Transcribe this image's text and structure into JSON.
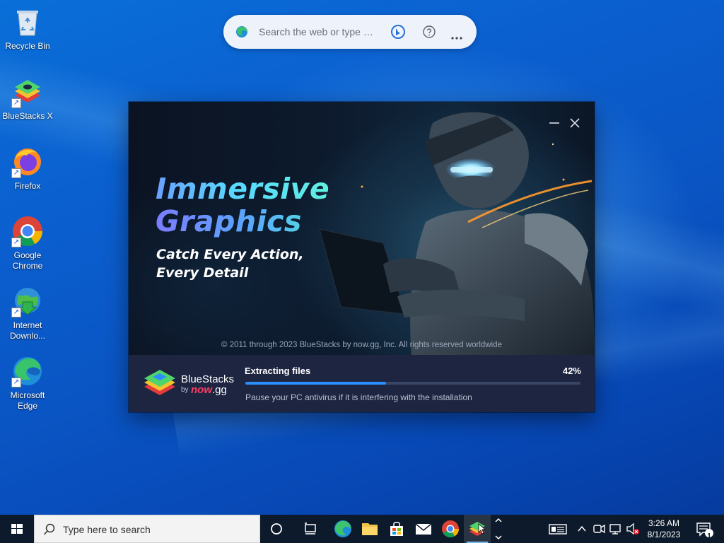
{
  "desktop": {
    "icons": [
      {
        "label": "Recycle Bin"
      },
      {
        "label": "BlueStacks X"
      },
      {
        "label": "Firefox"
      },
      {
        "label": "Google Chrome"
      },
      {
        "label": "Internet Downlo..."
      },
      {
        "label": "Microsoft Edge"
      }
    ]
  },
  "edge_bar": {
    "placeholder": "Search the web or type a URL"
  },
  "installer": {
    "hero": {
      "title_line1": "Immersive",
      "title_line2": "Graphics",
      "subtitle_line1": "Catch Every Action,",
      "subtitle_line2": "Every Detail",
      "copyright": "© 2011 through 2023 BlueStacks by now.gg, Inc. All rights reserved worldwide"
    },
    "brand": {
      "name": "BlueStacks",
      "by": "by",
      "nowgg_now": "now",
      "nowgg_gg": ".gg"
    },
    "status": "Extracting files",
    "progress_percent_label": "42%",
    "progress_fraction": 0.42,
    "hint": "Pause your PC antivirus if it is interfering with the installation"
  },
  "taskbar": {
    "search_placeholder": "Type here to search",
    "time": "3:26 AM",
    "date": "8/1/2023",
    "notification_count": "1"
  },
  "colors": {
    "accent": "#2b8fff",
    "footer_bg": "#1d2540",
    "taskbar_bg": "#0d1a2b"
  }
}
